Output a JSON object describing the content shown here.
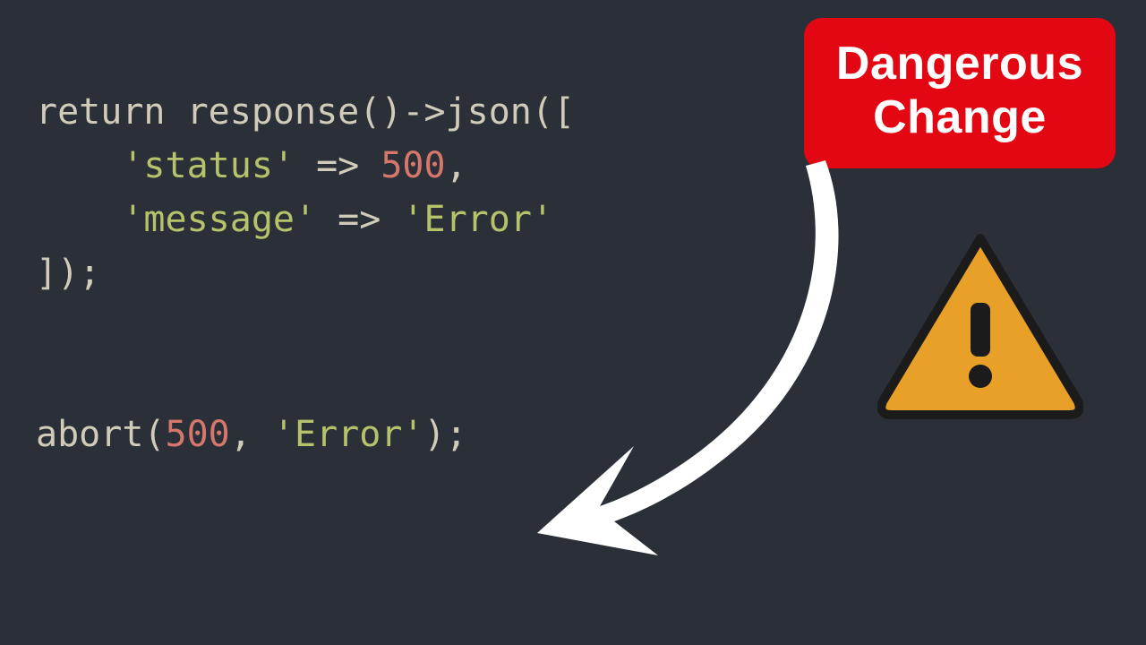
{
  "badge": {
    "line1": "Dangerous",
    "line2": "Change"
  },
  "code": {
    "l1_a": "return response()->json([",
    "l2_a": "    ",
    "l2_key": "'status'",
    "l2_b": " => ",
    "l2_num": "500",
    "l2_c": ",",
    "l3_a": "    ",
    "l3_key": "'message'",
    "l3_b": " => ",
    "l3_val": "'Error'",
    "l4_a": "]);",
    "l7_a": "abort(",
    "l7_num": "500",
    "l7_b": ", ",
    "l7_val": "'Error'",
    "l7_c": ");"
  }
}
